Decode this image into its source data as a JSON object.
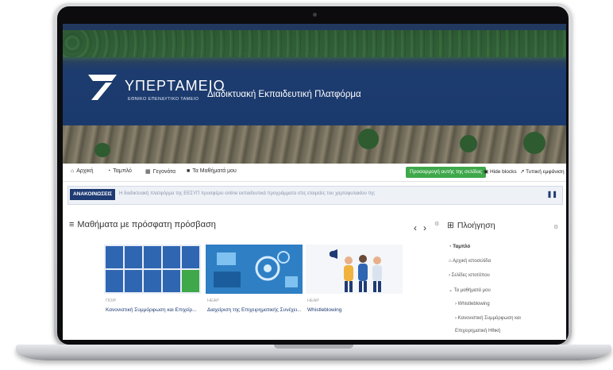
{
  "header": {
    "brand": "ΥΠΕΡΤΑΜΕΙΟ",
    "brand_sub": "ΕΘΝΙΚΟ ΕΠΕΝΔΥΤΙΚΟ ΤΑΜΕΙΟ",
    "platform_title": "Διαδικτυακή Εκπαιδευτική Πλατφόρμα"
  },
  "nav": {
    "home": "Αρχική",
    "dashboard": "Ταμπλό",
    "events": "Γεγονότα",
    "my_courses": "Τα Μαθήματά μου",
    "customize": "Προσαρμογή αυτής της σελίδας",
    "hide_blocks": "Hide blocks",
    "view": "Τυπική εμφάνιση"
  },
  "announcements": {
    "badge": "ΑΝΑΚΟΙΝΩΣΕΙΣ",
    "text": "Η διαδικτυακή πλατφόρμα της ΕΕΣΥΠ προσφέρει online εκπαιδευτικά προγράμματα στις εταιρείες του χαρτοφυλακίου της"
  },
  "recent": {
    "title": "Μαθήματα με πρόσφατη πρόσβαση",
    "courses": [
      {
        "category": "ΠΟΙΡ",
        "title": "Κανονιστική Συμμόρφωση και Επιχείρ..."
      },
      {
        "category": "ΗΕΑΡ",
        "title": "Διαχείριση της Επιχειρηματικής Συνέχει..."
      },
      {
        "category": "ΗΕΑΡ",
        "title": "Whistleblowing"
      }
    ]
  },
  "navigation": {
    "title": "Πλοήγηση",
    "items": [
      "Ταμπλό",
      "Αρχική ιστοσελίδα",
      "Σελίδες ιστοτόπου",
      "Τα μαθήματά μου",
      "Whistleblowing",
      "Κανονιστική Συμμόρφωση και",
      "Επιχειρηματική Ηθική"
    ]
  },
  "colors": {
    "primary": "#1f3b73",
    "green": "#3ea84a",
    "frame": "#0c0c0e"
  }
}
